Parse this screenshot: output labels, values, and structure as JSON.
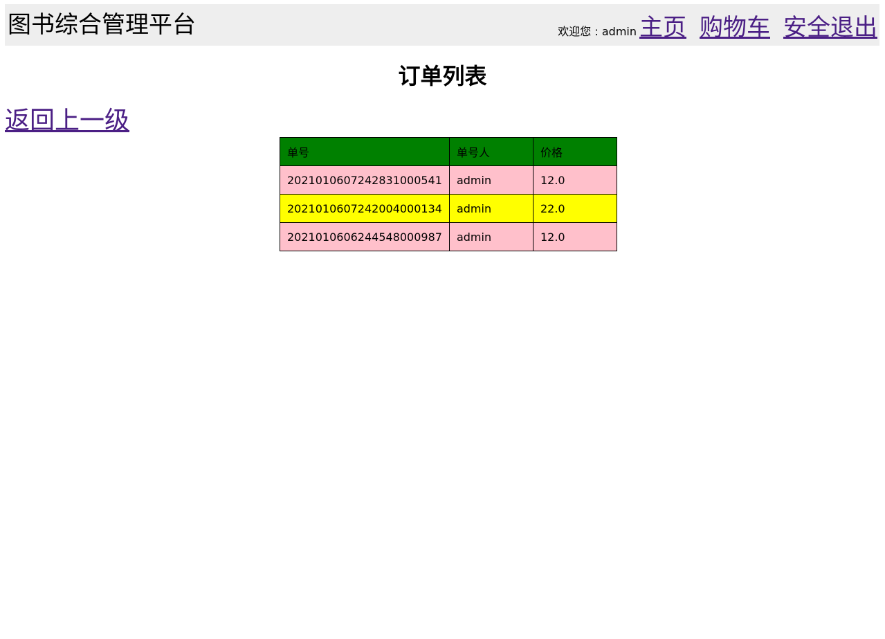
{
  "header": {
    "site_title": "图书综合管理平台",
    "welcome_text": "欢迎您 : admin",
    "nav": {
      "home": "主页",
      "cart": "购物车",
      "logout": "安全退出"
    }
  },
  "main": {
    "heading": "订单列表",
    "back_link": "返回上一级",
    "table": {
      "columns": [
        "单号",
        "单号人",
        "价格"
      ],
      "rows": [
        {
          "order_id": "2021010607242831000541",
          "user": "admin",
          "price": "12.0",
          "row_color": "#ffc0cb"
        },
        {
          "order_id": "2021010607242004000134",
          "user": "admin",
          "price": "22.0",
          "row_color": "#ffff00"
        },
        {
          "order_id": "2021010606244548000987",
          "user": "admin",
          "price": "12.0",
          "row_color": "#ffc0cb"
        }
      ]
    }
  },
  "colors": {
    "header_bg": "#eeeeee",
    "table_header_bg": "#008000",
    "link": "#4b1f85",
    "row_pink": "#ffc0cb",
    "row_yellow": "#ffff00"
  }
}
